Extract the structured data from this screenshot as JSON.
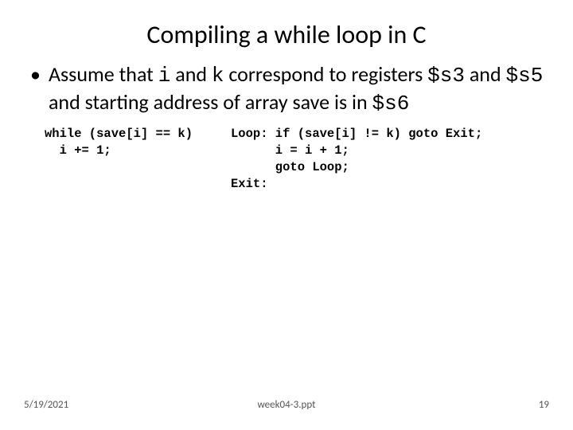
{
  "title": "Compiling a while loop in C",
  "bullet": {
    "pre": "Assume that ",
    "c1": "i",
    "mid1": " and ",
    "c2": "k",
    "mid2": " correspond to registers ",
    "c3": "$s3",
    "mid3": " and ",
    "c4": "$s5",
    "mid4": " and starting address of array save is in ",
    "c5": "$s6"
  },
  "code_left": "while (save[i] == k)\n  i += 1;",
  "code_right": "Loop: if (save[i] != k) goto Exit;\n      i = i + 1;\n      goto Loop;\nExit:",
  "footer": {
    "date": "5/19/2021",
    "file": "week04-3.ppt",
    "page": "19"
  }
}
